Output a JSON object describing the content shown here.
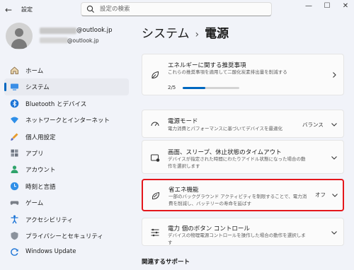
{
  "titlebar": {
    "app_title": "設定",
    "search_placeholder": "設定の検索"
  },
  "profile": {
    "email_primary": "@outlook.jp",
    "email_secondary": "@outlook.jp"
  },
  "sidebar": {
    "items": [
      {
        "label": "ホーム",
        "icon": "home-icon",
        "selected": false
      },
      {
        "label": "システム",
        "icon": "system-icon",
        "selected": true
      },
      {
        "label": "Bluetooth とデバイス",
        "icon": "bluetooth-icon",
        "selected": false
      },
      {
        "label": "ネットワークとインターネット",
        "icon": "network-icon",
        "selected": false
      },
      {
        "label": "個人用設定",
        "icon": "personalization-icon",
        "selected": false
      },
      {
        "label": "アプリ",
        "icon": "apps-icon",
        "selected": false
      },
      {
        "label": "アカウント",
        "icon": "accounts-icon",
        "selected": false
      },
      {
        "label": "時刻と言語",
        "icon": "time-language-icon",
        "selected": false
      },
      {
        "label": "ゲーム",
        "icon": "gaming-icon",
        "selected": false
      },
      {
        "label": "アクセシビリティ",
        "icon": "accessibility-icon",
        "selected": false
      },
      {
        "label": "プライバシーとセキュリティ",
        "icon": "privacy-shield-icon",
        "selected": false
      },
      {
        "label": "Windows Update",
        "icon": "windows-update-icon",
        "selected": false
      }
    ]
  },
  "breadcrumb": {
    "parent": "システム",
    "separator": "›",
    "current": "電源"
  },
  "cards": {
    "recommendations": {
      "title": "エネルギーに関する推奨事項",
      "desc": "これらの推奨事項を適用して二酸化炭素排出量を削減する",
      "progress_text": "2/5",
      "progress_fraction": 0.4
    },
    "power_mode": {
      "title": "電源モード",
      "desc": "電力消費とパフォーマンスに基づいてデバイスを最適化",
      "value": "バランス"
    },
    "screen_sleep": {
      "title": "画面、スリープ、休止状態のタイムアウト",
      "desc": "デバイスが指定された時間にわたりアイドル状態になった場合の動作を選択します"
    },
    "energy_saver": {
      "title": "省エネ機能",
      "desc": "一部のバックグラウンド アクティビティを制限することで、電力消費を削減し、バッテリーの寿命を延ばす",
      "value": "オフ"
    },
    "power_button": {
      "title": "電力 個のボタン コントロール",
      "desc": "デバイスの物理電源コントロールを操作した場合の動作を選択します"
    }
  },
  "related_support": {
    "heading": "関連するサポート"
  },
  "colors": {
    "accent": "#0067c0",
    "highlight_border": "#e4161b"
  }
}
